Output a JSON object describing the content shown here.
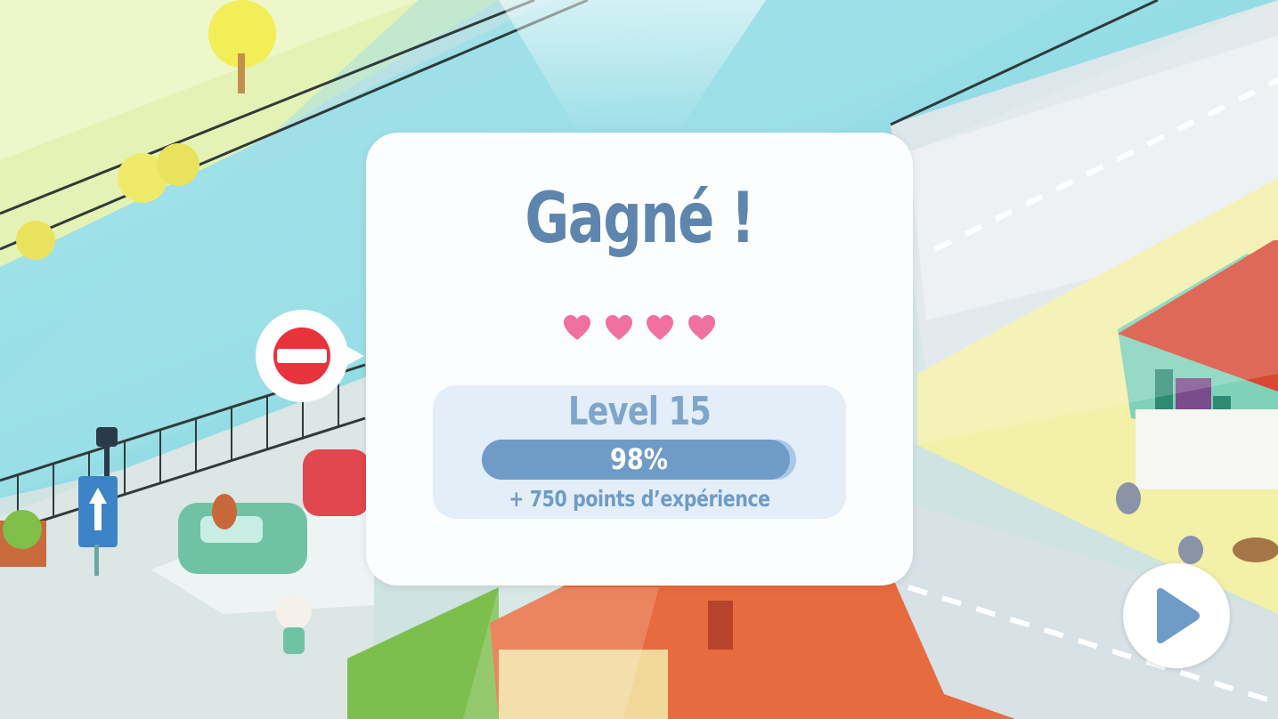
{
  "result": {
    "title": "Gagné !",
    "hearts": 4
  },
  "level": {
    "label": "Level 15",
    "progress_text": "98%",
    "progress": 0.98,
    "xp_text": "+ 750 points d’expérience"
  },
  "icons": {
    "heart": "heart-icon",
    "next": "play-arrow-icon",
    "sign": "no-entry-sign-icon"
  },
  "colors": {
    "title": "#5e85ad",
    "heart": "#f0709f",
    "bar_fill": "#6f9bc7",
    "bar_track": "#a9c8e8",
    "panel": "#e3eef9"
  }
}
